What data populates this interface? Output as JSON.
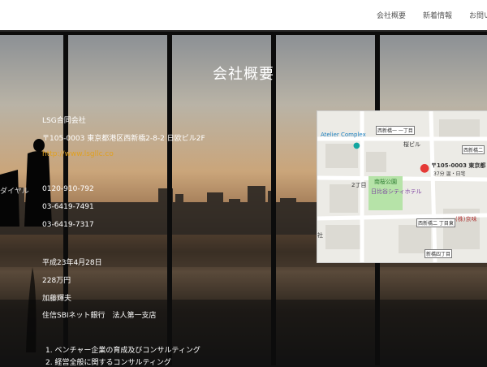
{
  "nav": {
    "items": [
      "会社概要",
      "新着情報",
      "お問い"
    ]
  },
  "hero": {
    "title": "会社概要",
    "left_label": "ダイヤル"
  },
  "company": {
    "name": "LSG合同会社",
    "address": "〒105-0003 東京都港区西新橋2-8-2 日欧ビル2F",
    "url": "http://www.lsgllc.co",
    "phone1": "0120-910-792",
    "phone2": "03-6419-7491",
    "phone3": "03-6419-7317",
    "founded": "平成23年4月28日",
    "capital": "228万円",
    "representative": "加藤輝夫",
    "bank": "住信SBIネット銀行　法人第一支店",
    "business1": "1. ベンチャー企業の育成及びコンサルティング",
    "business2": "2. 経営全般に関するコンサルティング"
  },
  "map": {
    "poi1": "Atelier Complex",
    "poi2": "西新橋一\n一丁目",
    "poi3": "桜ビル",
    "poi4": "西新橋二",
    "pin_label": "〒105-0003 東京都",
    "pin_sub": "37分 温・日宅",
    "area": "2丁目",
    "park": "南桜公園",
    "hotel": "日比谷シティホテル",
    "poi5": "西新橋二\n丁目東",
    "poi6": "(株)京味",
    "poi7": "新橋四丁目",
    "edge": "社"
  },
  "colors": {
    "accent_link": "#e0a020",
    "pin": "#e53935",
    "park": "#b6e3a8"
  }
}
